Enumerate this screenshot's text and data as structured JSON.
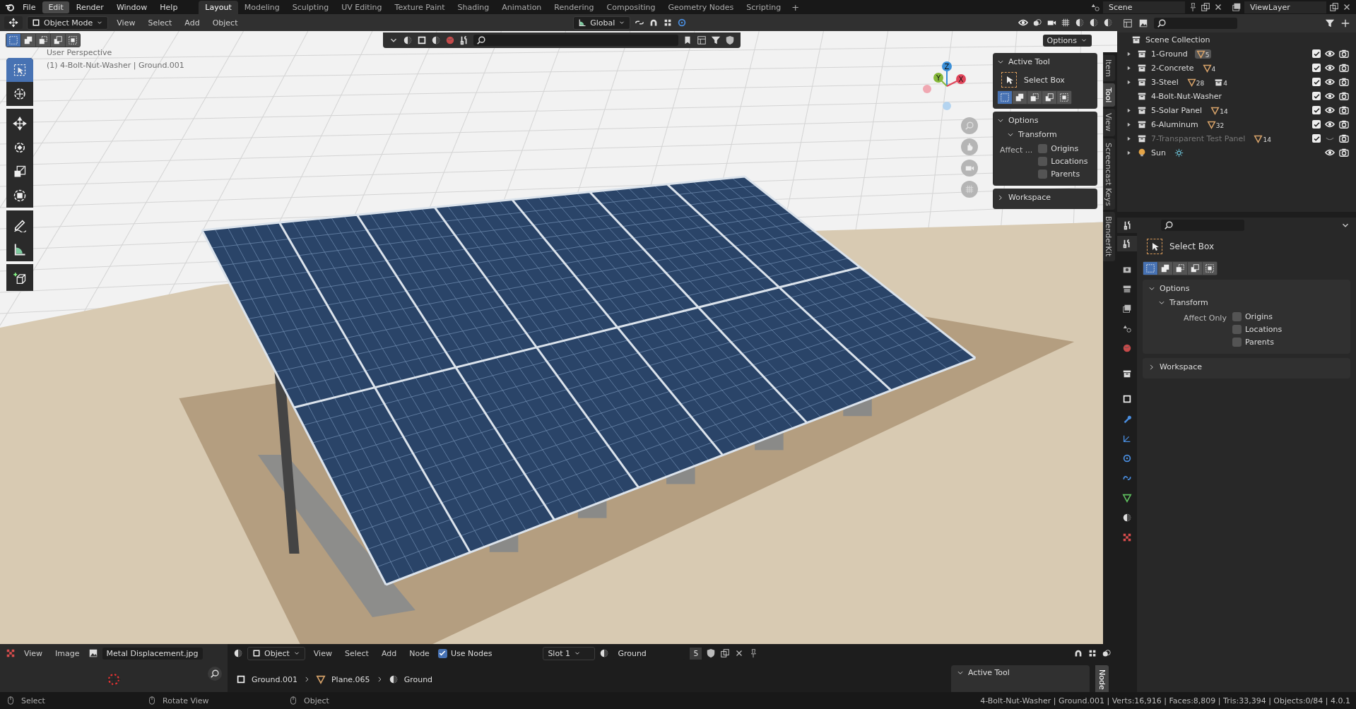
{
  "menu_bar": {
    "menus": [
      {
        "label": "File",
        "selected": false
      },
      {
        "label": "Edit",
        "selected": true
      },
      {
        "label": "Render",
        "selected": false
      },
      {
        "label": "Window",
        "selected": false
      },
      {
        "label": "Help",
        "selected": false
      }
    ],
    "workspaces": [
      {
        "label": "Layout",
        "selected": true
      },
      {
        "label": "Modeling",
        "selected": false
      },
      {
        "label": "Sculpting",
        "selected": false
      },
      {
        "label": "UV Editing",
        "selected": false
      },
      {
        "label": "Texture Paint",
        "selected": false
      },
      {
        "label": "Shading",
        "selected": false
      },
      {
        "label": "Animation",
        "selected": false
      },
      {
        "label": "Rendering",
        "selected": false
      },
      {
        "label": "Compositing",
        "selected": false
      },
      {
        "label": "Geometry Nodes",
        "selected": false
      },
      {
        "label": "Scripting",
        "selected": false
      }
    ],
    "add_workspace": "+",
    "scene": "Scene",
    "view_layer": "ViewLayer"
  },
  "viewport": {
    "header": {
      "mode": "Object Mode",
      "menus": [
        "View",
        "Select",
        "Add",
        "Object"
      ],
      "orientation": "Global",
      "options": "Options"
    },
    "select_modes": [
      {
        "selected": true
      },
      {
        "selected": false
      },
      {
        "selected": false
      },
      {
        "selected": false
      },
      {
        "selected": false
      }
    ],
    "overlay_text": [
      "User Perspective",
      "(1) 4-Bolt-Nut-Washer | Ground.001"
    ],
    "gizmo_axes": [
      {
        "label": "X",
        "color": "#e0455a"
      },
      {
        "label": "Y",
        "color": "#86b83a"
      },
      {
        "label": "Z",
        "color": "#3a8fd8"
      }
    ],
    "tools": [
      {
        "kind": "select-box",
        "selected": true
      },
      {
        "kind": "cursor",
        "selected": false
      },
      {
        "kind": "move",
        "selected": false
      },
      {
        "kind": "rotate",
        "selected": false
      },
      {
        "kind": "scale",
        "selected": false
      },
      {
        "kind": "transform",
        "selected": false
      },
      {
        "kind": "annotate",
        "selected": false
      },
      {
        "kind": "measure",
        "selected": false
      },
      {
        "kind": "add-cube",
        "selected": false
      }
    ],
    "sidebar": {
      "tabs": [
        {
          "label": "Item",
          "selected": false
        },
        {
          "label": "Tool",
          "selected": true
        },
        {
          "label": "View",
          "selected": false
        },
        {
          "label": "Screencast Keys",
          "selected": false
        },
        {
          "label": "BlenderKit",
          "selected": false
        }
      ],
      "active_tool": {
        "title": "Active Tool",
        "expanded": true,
        "tool": "Select Box"
      },
      "options": {
        "title": "Options",
        "expanded": true,
        "transform": "Transform",
        "affect_label": "Affect ...",
        "checkboxes": [
          {
            "label": "Origins",
            "checked": false
          },
          {
            "label": "Locations",
            "checked": false
          },
          {
            "label": "Parents",
            "checked": false
          }
        ]
      },
      "workspace": {
        "title": "Workspace",
        "expanded": false
      }
    }
  },
  "outliner": {
    "root": "Scene Collection",
    "items": [
      {
        "name": "1-Ground",
        "kind": "collection",
        "expandable": true,
        "dimmed": false,
        "included": true,
        "visible": true,
        "badges": [
          {
            "kind": "mesh",
            "count": "5",
            "highlighted": true
          }
        ]
      },
      {
        "name": "2-Concrete",
        "kind": "collection",
        "expandable": true,
        "dimmed": false,
        "included": true,
        "visible": true,
        "badges": [
          {
            "kind": "mesh",
            "count": "4",
            "highlighted": false
          }
        ]
      },
      {
        "name": "3-Steel",
        "kind": "collection",
        "expandable": true,
        "dimmed": false,
        "included": true,
        "visible": true,
        "badges": [
          {
            "kind": "mesh",
            "count": "28",
            "highlighted": false
          },
          {
            "kind": "collection",
            "count": "4",
            "highlighted": false
          }
        ]
      },
      {
        "name": "4-Bolt-Nut-Washer",
        "kind": "collection",
        "expandable": false,
        "dimmed": false,
        "included": true,
        "visible": true
      },
      {
        "name": "5-Solar Panel",
        "kind": "collection",
        "expandable": true,
        "dimmed": false,
        "included": true,
        "visible": true,
        "badges": [
          {
            "kind": "mesh",
            "count": "14",
            "highlighted": false
          }
        ]
      },
      {
        "name": "6-Aluminum",
        "kind": "collection",
        "expandable": true,
        "dimmed": false,
        "included": true,
        "visible": true,
        "badges": [
          {
            "kind": "mesh",
            "count": "32",
            "highlighted": false
          }
        ]
      },
      {
        "name": "7-Transparent Test Panel",
        "kind": "collection",
        "expandable": true,
        "dimmed": true,
        "included": true,
        "visible": false,
        "badges": [
          {
            "kind": "mesh",
            "count": "14",
            "highlighted": false
          }
        ]
      },
      {
        "name": "Sun",
        "kind": "light",
        "expandable": true,
        "dimmed": false,
        "visible": true,
        "badges": [
          {
            "kind": "sun",
            "highlighted": false
          }
        ]
      }
    ]
  },
  "properties": {
    "tabs": [
      {
        "kind": "tool",
        "selected": true
      },
      {
        "kind": "render",
        "selected": false
      },
      {
        "kind": "output",
        "selected": false
      },
      {
        "kind": "view-layer",
        "selected": false
      },
      {
        "kind": "scene",
        "selected": false
      },
      {
        "kind": "world",
        "selected": false
      },
      {
        "kind": "collection",
        "selected": false
      },
      {
        "kind": "object",
        "selected": false
      },
      {
        "kind": "wrench",
        "selected": false
      },
      {
        "kind": "particles",
        "selected": false
      },
      {
        "kind": "physics",
        "selected": false
      },
      {
        "kind": "constraints",
        "selected": false
      },
      {
        "kind": "data",
        "selected": false
      },
      {
        "kind": "material",
        "selected": false
      },
      {
        "kind": "texture",
        "selected": false
      }
    ],
    "tool": "Select Box",
    "select_modes": [
      {
        "selected": true
      },
      {
        "selected": false
      },
      {
        "selected": false
      },
      {
        "selected": false
      },
      {
        "selected": false
      }
    ],
    "options": {
      "title": "Options",
      "expanded": true,
      "transform": "Transform",
      "affect_label": "Affect Only",
      "checkboxes": [
        {
          "label": "Origins",
          "checked": false
        },
        {
          "label": "Locations",
          "checked": false
        },
        {
          "label": "Parents",
          "checked": false
        }
      ]
    },
    "workspace": {
      "title": "Workspace",
      "expanded": false
    }
  },
  "image_editor": {
    "menus": [
      "View",
      "Image"
    ],
    "image": "Metal Displacement.jpg"
  },
  "shader_editor": {
    "object": "Object",
    "menus": [
      "View",
      "Select",
      "Add",
      "Node"
    ],
    "use_nodes": {
      "label": "Use Nodes",
      "checked": true
    },
    "slot": "Slot 1",
    "material": "Ground",
    "users": "5",
    "breadcrumbs": [
      {
        "kind": "object",
        "label": "Ground.001"
      },
      {
        "kind": "mesh",
        "label": "Plane.065"
      },
      {
        "kind": "material",
        "label": "Ground"
      }
    ],
    "sidebar": {
      "title": "Active Tool",
      "expanded": true,
      "tab": "Node"
    }
  },
  "status_bar": {
    "hints": [
      "Select",
      "Rotate View",
      "Object"
    ],
    "stats": "4-Bolt-Nut-Washer | Ground.001 | Verts:16,916 | Faces:8,809 | Tris:33,394 | Objects:0/84 | 4.0.1"
  }
}
